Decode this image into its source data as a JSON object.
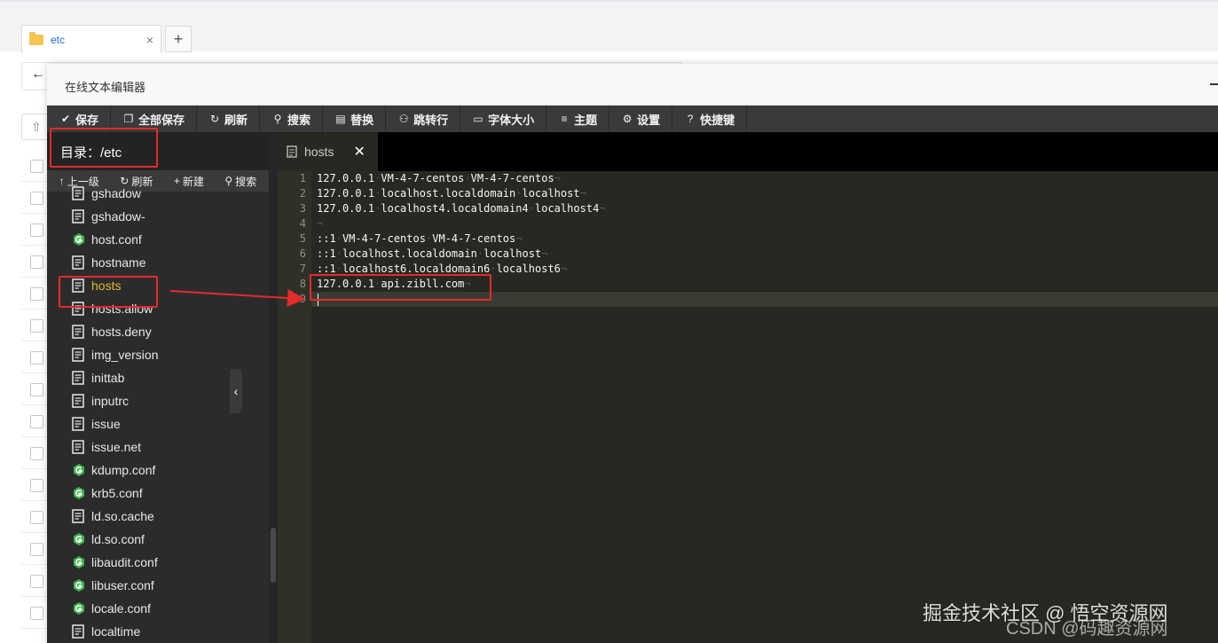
{
  "background": {
    "tab_label": "etc",
    "tab_close": "×",
    "tab_add": "+",
    "back_arrow": "←"
  },
  "dialog": {
    "title": "在线文本编辑器"
  },
  "toolbar": {
    "buttons": [
      {
        "label": "保存",
        "icon": "check-icon"
      },
      {
        "label": "全部保存",
        "icon": "copy-icon"
      },
      {
        "label": "刷新",
        "icon": "refresh-icon"
      },
      {
        "label": "搜索",
        "icon": "search-icon"
      },
      {
        "label": "替换",
        "icon": "replace-icon"
      },
      {
        "label": "跳转行",
        "icon": "jump-icon"
      },
      {
        "label": "字体大小",
        "icon": "font-size-icon"
      },
      {
        "label": "主题",
        "icon": "menu-icon"
      },
      {
        "label": "设置",
        "icon": "gear-icon"
      },
      {
        "label": "快捷键",
        "icon": "help-icon"
      }
    ]
  },
  "sidebar": {
    "directory_label": "目录：/etc",
    "tools": [
      {
        "label": "上一级",
        "icon": "arrow-up-icon"
      },
      {
        "label": "刷新",
        "icon": "refresh-icon"
      },
      {
        "label": "新建",
        "icon": "plus-icon"
      },
      {
        "label": "搜索",
        "icon": "search-icon"
      }
    ],
    "files": [
      {
        "name": "gshadow",
        "type": "text"
      },
      {
        "name": "gshadow-",
        "type": "text"
      },
      {
        "name": "host.conf",
        "type": "config"
      },
      {
        "name": "hostname",
        "type": "text"
      },
      {
        "name": "hosts",
        "type": "text",
        "active": true
      },
      {
        "name": "hosts.allow",
        "type": "text"
      },
      {
        "name": "hosts.deny",
        "type": "text"
      },
      {
        "name": "img_version",
        "type": "text"
      },
      {
        "name": "inittab",
        "type": "text"
      },
      {
        "name": "inputrc",
        "type": "text"
      },
      {
        "name": "issue",
        "type": "text"
      },
      {
        "name": "issue.net",
        "type": "text"
      },
      {
        "name": "kdump.conf",
        "type": "config"
      },
      {
        "name": "krb5.conf",
        "type": "config"
      },
      {
        "name": "ld.so.cache",
        "type": "text"
      },
      {
        "name": "ld.so.conf",
        "type": "config"
      },
      {
        "name": "libaudit.conf",
        "type": "config"
      },
      {
        "name": "libuser.conf",
        "type": "config"
      },
      {
        "name": "locale.conf",
        "type": "config"
      },
      {
        "name": "localtime",
        "type": "text"
      }
    ]
  },
  "editor": {
    "tab_label": "hosts",
    "tab_close": "✕",
    "collapse_glyph": "‹",
    "lines": [
      {
        "n": "1",
        "text": "127.0.0.1·VM-4-7-centos·VM-4-7-centos¬"
      },
      {
        "n": "2",
        "text": "127.0.0.1·localhost.localdomain·localhost¬"
      },
      {
        "n": "3",
        "text": "127.0.0.1·localhost4.localdomain4·localhost4¬"
      },
      {
        "n": "4",
        "text": "¬"
      },
      {
        "n": "5",
        "text": "::1·VM-4-7-centos·VM-4-7-centos¬"
      },
      {
        "n": "6",
        "text": "::1·localhost.localdomain·localhost¬"
      },
      {
        "n": "7",
        "text": "::1·localhost6.localdomain6·localhost6¬"
      },
      {
        "n": "8",
        "text": "127.0.0.1·api.zibll.com¬"
      },
      {
        "n": "9",
        "text": ""
      }
    ],
    "current_line": "9"
  },
  "colors": {
    "annotation_red": "#e52a2a",
    "active_file": "#e2b832",
    "config_icon": "#3cb44a",
    "editor_bg": "#272822"
  },
  "watermark": {
    "line1": "掘金技术社区 @ 悟空资源网",
    "line2": "CSDN @码趣资源网"
  }
}
